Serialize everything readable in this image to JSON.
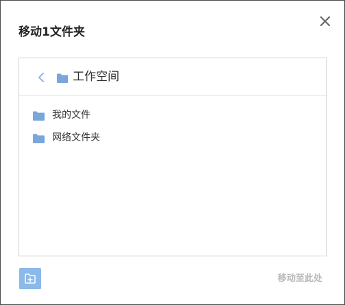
{
  "dialog": {
    "title": "移动1文件夹",
    "close_icon": "close-icon"
  },
  "browser": {
    "back_icon": "chevron-left-icon",
    "current_folder_icon": "folder-icon",
    "current_folder": "工作空间",
    "items": [
      {
        "icon": "folder-icon",
        "label": "我的文件"
      },
      {
        "icon": "folder-icon",
        "label": "网络文件夹"
      }
    ]
  },
  "footer": {
    "new_folder_icon": "new-folder-icon",
    "move_here_label": "移动至此处"
  },
  "colors": {
    "accent": "#8ab9ea",
    "folder": "#7aa7db",
    "disabled_text": "#b8b8b8"
  }
}
